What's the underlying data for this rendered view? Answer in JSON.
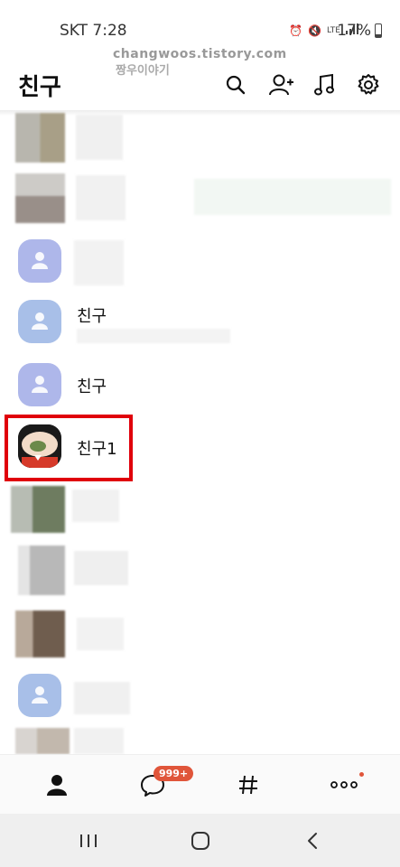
{
  "status_bar": {
    "time": "SKT 7:28",
    "battery": "17%",
    "network_label": "LTE"
  },
  "watermark": {
    "line1": "changwoos.tistory.com",
    "line2": "짱우이야기"
  },
  "header": {
    "title": "친구",
    "icons": [
      "search-icon",
      "add-friend-icon",
      "music-icon",
      "settings-icon"
    ]
  },
  "friends": [
    {
      "name": ""
    },
    {
      "name": ""
    },
    {
      "name": ""
    },
    {
      "name": "친구"
    },
    {
      "name": "친구"
    },
    {
      "name": "친구1"
    },
    {
      "name": ""
    },
    {
      "name": ""
    },
    {
      "name": ""
    },
    {
      "name": ""
    },
    {
      "name": ""
    }
  ],
  "bottom_nav": {
    "items": [
      "friends-tab",
      "chats-tab",
      "openchat-tab",
      "more-tab"
    ],
    "chat_badge": "999+"
  },
  "colors": {
    "badge": "#e0553a",
    "highlight": "#e0000b",
    "avatar_default": "#a8bfe8"
  }
}
